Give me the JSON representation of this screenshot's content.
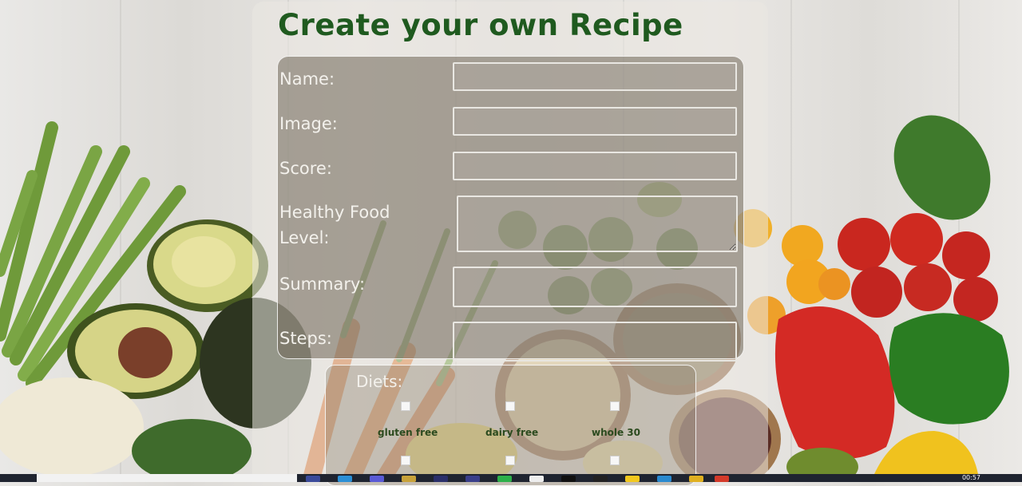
{
  "page": {
    "title": "Create your own Recipe"
  },
  "form": {
    "fields": [
      {
        "label": "Name:",
        "value": ""
      },
      {
        "label": "Image:",
        "value": ""
      },
      {
        "label": "Score:",
        "value": ""
      },
      {
        "label_line1": "Healthy Food",
        "label_line2": "Level:",
        "value": ""
      },
      {
        "label": "Summary:",
        "value": ""
      },
      {
        "label": "Steps:",
        "value": ""
      }
    ]
  },
  "diets": {
    "title": "Diets:",
    "options": [
      {
        "label": "gluten free",
        "checked": false
      },
      {
        "label": "dairy free",
        "checked": false
      },
      {
        "label": "whole 30",
        "checked": false
      }
    ]
  },
  "taskbar": {
    "clock": "00:57"
  },
  "colors": {
    "title_green": "#1f5a1f",
    "label_text": "#f3f1ec",
    "diet_label_green": "#2b4a1e"
  }
}
